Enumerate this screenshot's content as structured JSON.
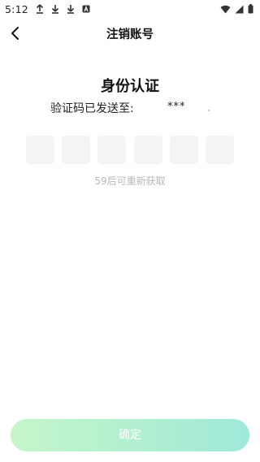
{
  "status_bar": {
    "time": "5:12",
    "icons": [
      "upload-icon",
      "download-icon",
      "download-icon",
      "a-app-icon",
      "wifi-icon",
      "signal-icon",
      "battery-icon"
    ]
  },
  "header": {
    "title": "注销账号",
    "back_icon": "chevron-left-icon"
  },
  "main": {
    "title": "身份认证",
    "sent_label": "验证码已发送至:",
    "phone_masked": "***",
    "code_boxes": [
      "",
      "",
      "",
      "",
      "",
      ""
    ],
    "resend_text": "59后可重新获取"
  },
  "footer": {
    "confirm_label": "确定"
  },
  "colors": {
    "code_box_bg": "#f3f4f6",
    "resend_text": "#b6b9bf",
    "button_gradient_start": "#c5f6c9",
    "button_gradient_end": "#9fe8d9"
  }
}
